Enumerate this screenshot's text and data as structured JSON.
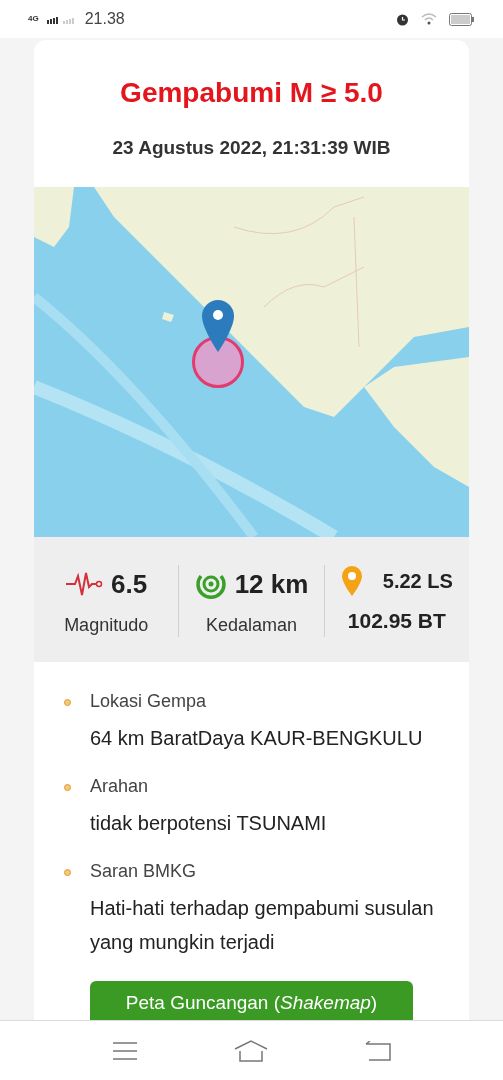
{
  "status_bar": {
    "network": "4G",
    "time": "21.38"
  },
  "card": {
    "title": "Gempabumi M ≥ 5.0",
    "datetime": "23 Agustus 2022, 21:31:39 WIB",
    "stats": [
      {
        "kind": "magnitude",
        "value": "6.5",
        "label": "Magnitudo"
      },
      {
        "kind": "depth",
        "value": "12 km",
        "label": "Kedalaman"
      },
      {
        "kind": "location",
        "value": "5.22 LS",
        "label": "102.95 BT"
      }
    ],
    "details": [
      {
        "label": "Lokasi Gempa",
        "text": "64 km BaratDaya KAUR-BENGKULU"
      },
      {
        "label": "Arahan",
        "text": "tidak berpotensi TSUNAMI"
      },
      {
        "label": "Saran BMKG",
        "text": "Hati-hati terhadap gempabumi susulan yang mungkin terjadi"
      }
    ],
    "button": "Peta Guncangan (*Shakemap*)"
  }
}
